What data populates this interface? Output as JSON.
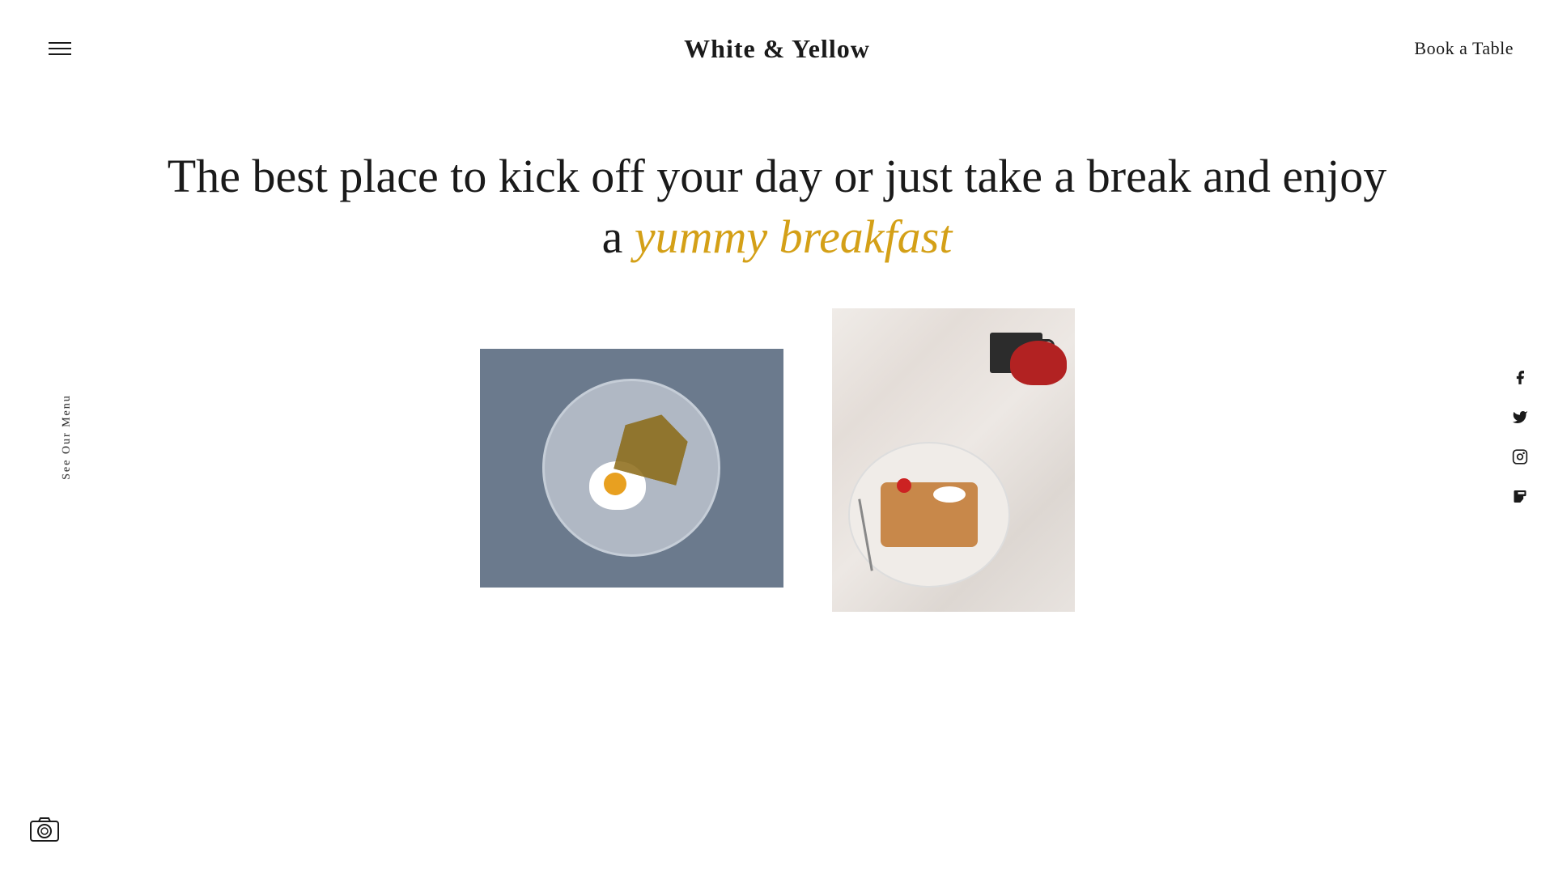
{
  "header": {
    "hamburger_label": "menu",
    "site_title": "White & Yellow",
    "book_table_label": "Book a Table"
  },
  "hero": {
    "text_main": "The best place to kick off your day or just take a break and enjoy a ",
    "text_highlight": "yummy breakfast"
  },
  "side": {
    "menu_text": "See Our Menu"
  },
  "social": {
    "facebook_label": "facebook",
    "twitter_label": "twitter",
    "instagram_label": "instagram",
    "foursquare_label": "foursquare"
  },
  "images": {
    "image1_alt": "Egg and toast on a plate",
    "image2_alt": "Pancakes with berries and coffee"
  },
  "colors": {
    "accent": "#d4a017",
    "text_dark": "#1a1a1a",
    "bg": "#ffffff"
  }
}
